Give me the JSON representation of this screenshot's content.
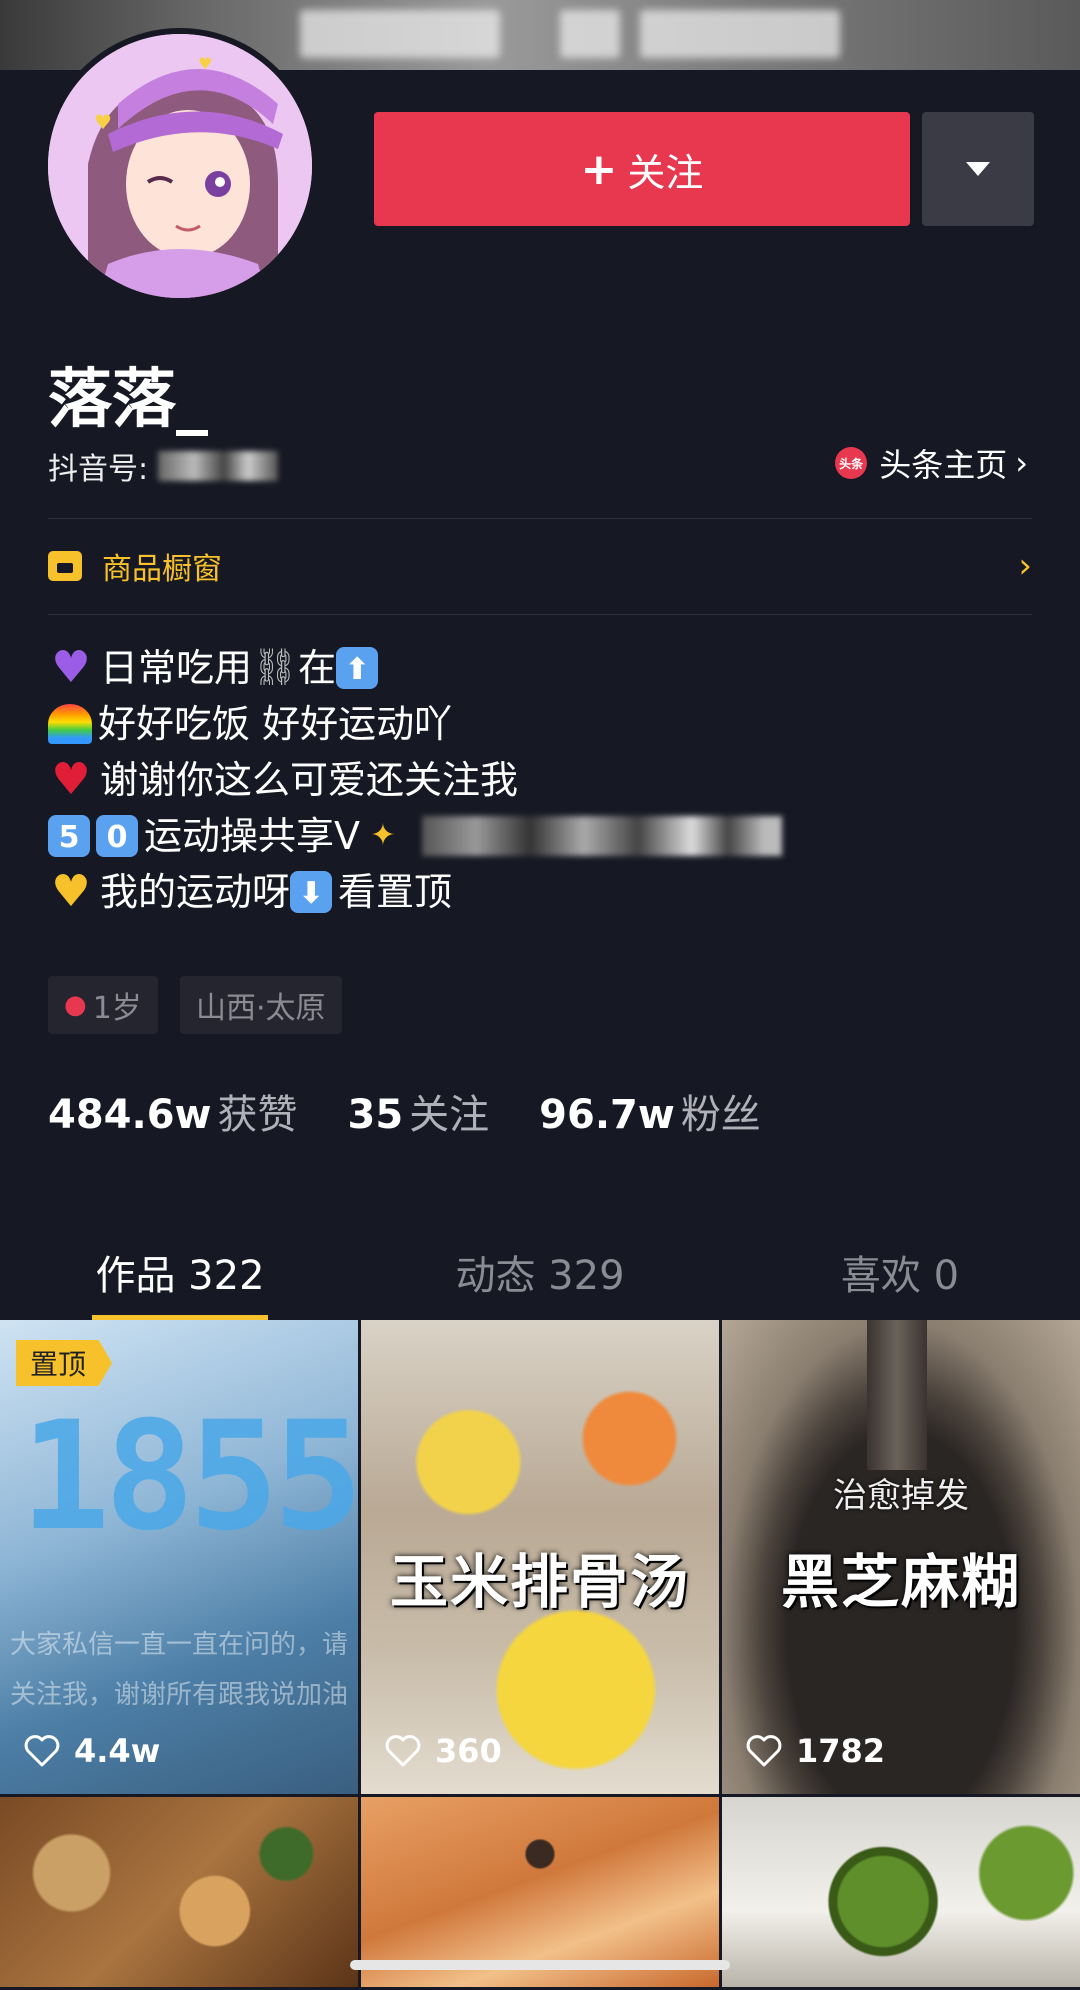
{
  "profile": {
    "nickname": "落落_",
    "douyin_id_label": "抖音号:",
    "toutiao_badge": "头条",
    "toutiao_link": "头条主页",
    "follow_label": "关注",
    "shop_label": "商品橱窗"
  },
  "bio": {
    "line1": "日常吃用",
    "line1b": "在",
    "line2": "好好吃饭 好好运动吖",
    "line3": "谢谢你这么可爱还关注我",
    "line4_digit1": "5",
    "line4_digit2": "0",
    "line4": "运动操共享V",
    "line5": "我的运动呀",
    "line5b": "看置顶"
  },
  "tags": {
    "age": "1岁",
    "location": "山西·太原"
  },
  "stats": {
    "likes_value": "484.6w",
    "likes_label": "获赞",
    "following_value": "35",
    "following_label": "关注",
    "followers_value": "96.7w",
    "followers_label": "粉丝"
  },
  "tabs": {
    "works": "作品 322",
    "dynamics": "动态 329",
    "likes": "喜欢 0"
  },
  "videos": [
    {
      "pinned_label": "置顶",
      "digits": "1855",
      "likes": "4.4w",
      "overlay_text": "大家私信一直一直在问的，请关注我，谢谢所有跟我说加油"
    },
    {
      "title": "玉米排骨汤",
      "likes": "360"
    },
    {
      "subtitle": "治愈掉发",
      "title": "黑芝麻糊",
      "likes": "1782"
    }
  ],
  "colors": {
    "background": "#161823",
    "follow_button": "#e8384f",
    "accent_yellow": "#f7c12b"
  }
}
